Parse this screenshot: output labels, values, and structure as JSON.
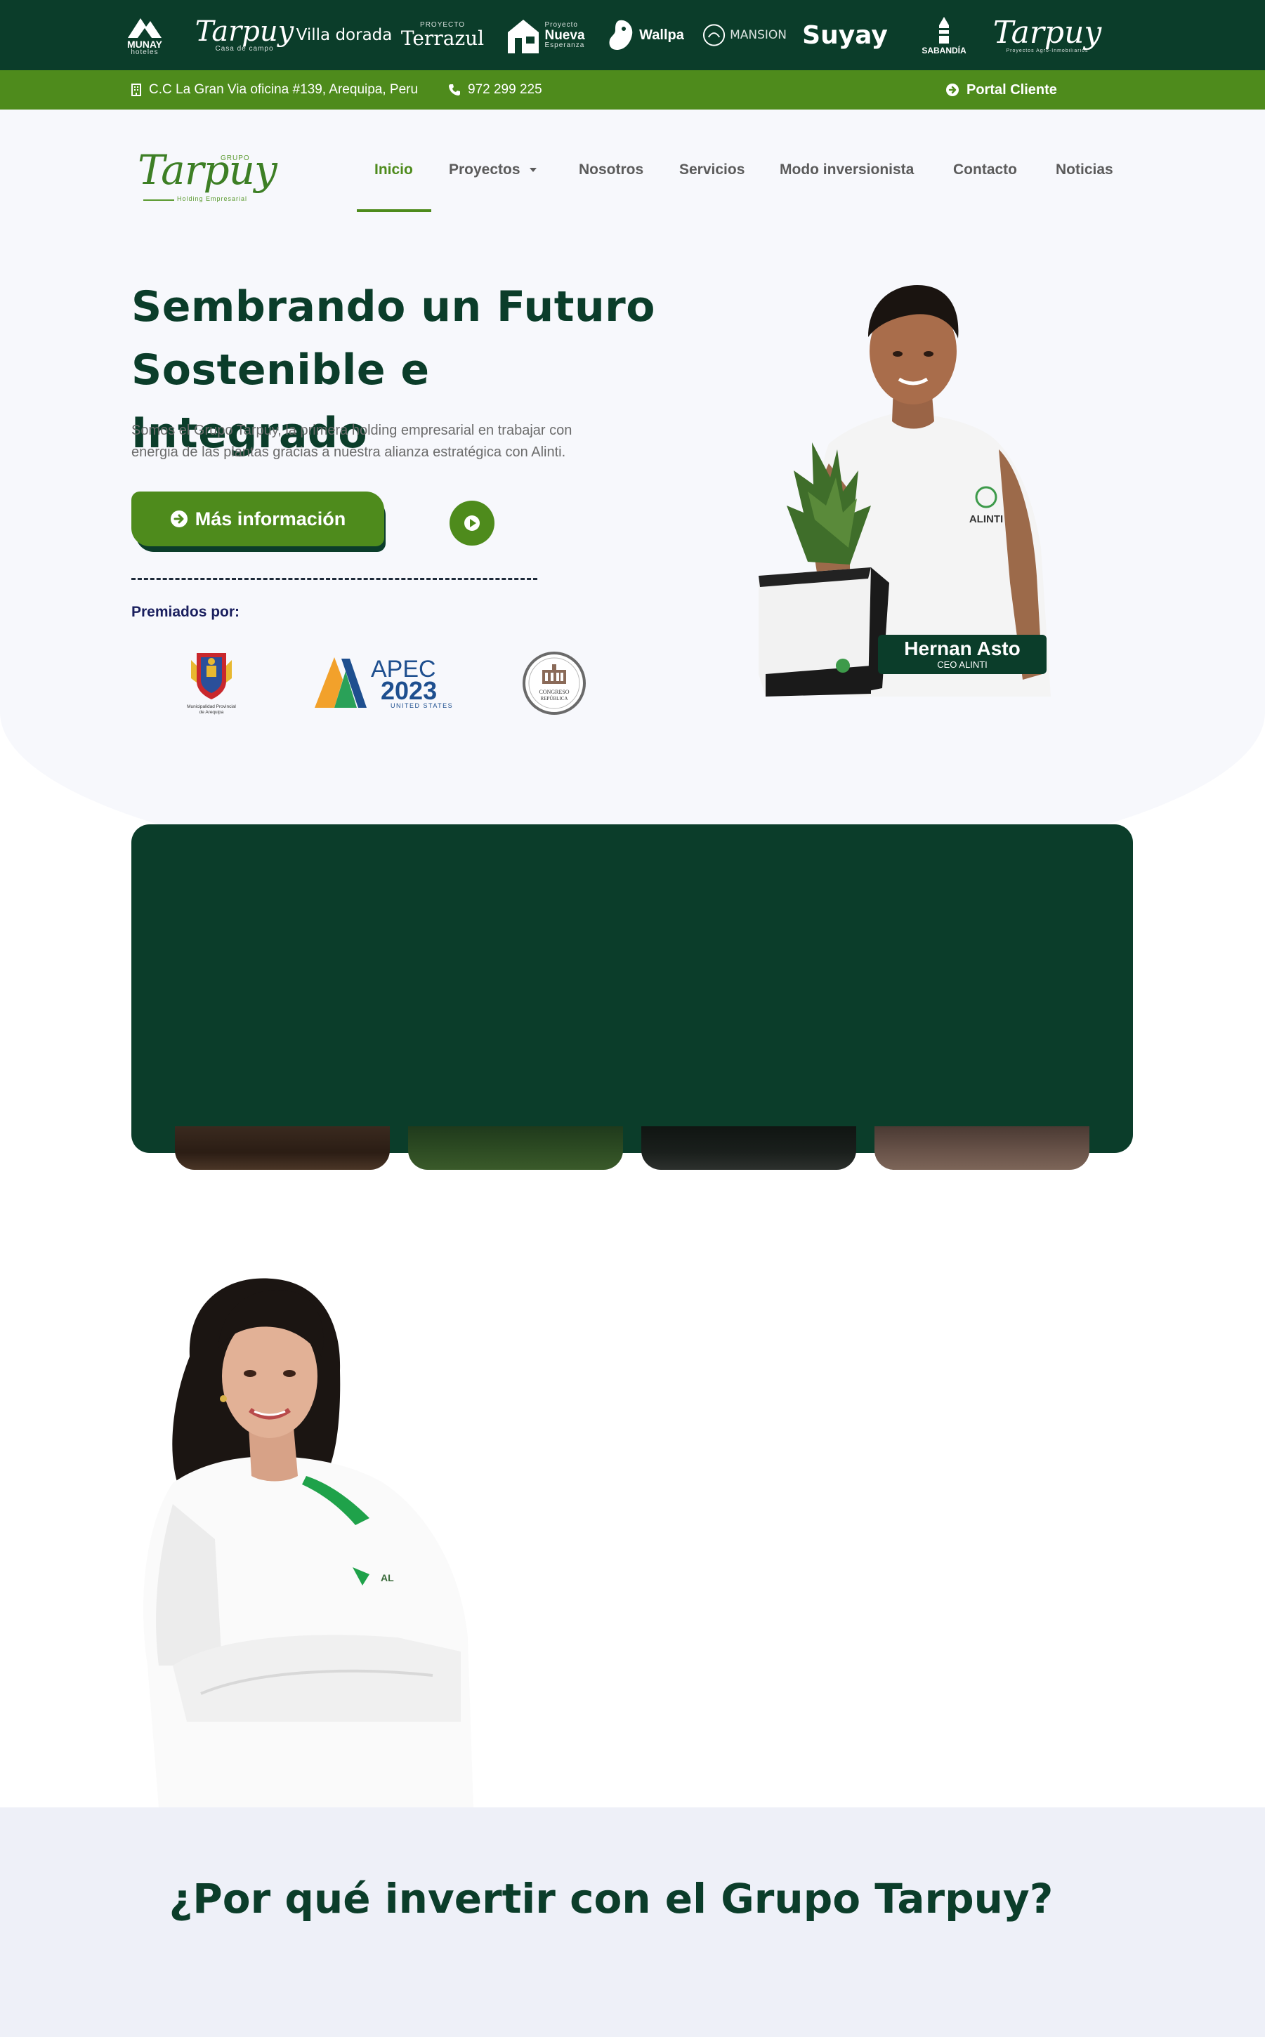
{
  "brands": [
    {
      "name": "MUNAY",
      "sub": "hoteles"
    },
    {
      "name": "Tarpuy",
      "sub": "Casa de campo"
    },
    {
      "name": "Villa dorada"
    },
    {
      "name": "Terrazul",
      "sub": "PROYECTO"
    },
    {
      "name": "Nueva",
      "sub": "Proyecto",
      "sub2": "Esperanza"
    },
    {
      "name": "Wallpa"
    },
    {
      "name": "MANSION"
    },
    {
      "name": "Suyay"
    },
    {
      "name": "SABANDÍA"
    },
    {
      "name": "Tarpuy",
      "sub": "Proyectos Agro-Inmobiliarios"
    }
  ],
  "info_bar": {
    "address": "C.C La Gran Via oficina #139, Arequipa, Peru",
    "phone": "972 299 225",
    "portal": "Portal Cliente"
  },
  "logo": {
    "grupo": "GRUPO",
    "name": "Tarpuy",
    "holding": "Holding Empresarial"
  },
  "nav": {
    "items": [
      "Inicio",
      "Proyectos",
      "Nosotros",
      "Servicios",
      "Modo inversionista",
      "Contacto",
      "Noticias"
    ],
    "active": "Inicio"
  },
  "hero": {
    "title_line1": "Sembrando un Futuro",
    "title_line2": "Sostenible e Integrado",
    "description_line1": "Somos el Grupo Tarpuy, la primera holding empresarial en trabajar con",
    "description_line2": "energia de las plantas gracias a nuestra alianza estratégica con Alinti.",
    "cta": "Más información",
    "awards_label": "Premiados por:"
  },
  "awards": {
    "muni_line1": "Municipalidad Provincial",
    "muni_line2": "de Arequipa",
    "apec_title": "APEC",
    "apec_year": "2023",
    "apec_sub": "UNITED STATES",
    "congreso_line1": "CONGRESO",
    "congreso_line2": "REPÚBLICA"
  },
  "ceo": {
    "name": "Hernan Asto",
    "role": "CEO ALINTI",
    "shirt_text": "ALINTI"
  },
  "section_why": {
    "title": "¿Por qué invertir con el Grupo Tarpuy?"
  },
  "colors": {
    "dark_green": "#0b3d2a",
    "brand_green": "#4e8b1c",
    "hero_bg": "#f7f8fc",
    "navy": "#1a1f5e"
  }
}
